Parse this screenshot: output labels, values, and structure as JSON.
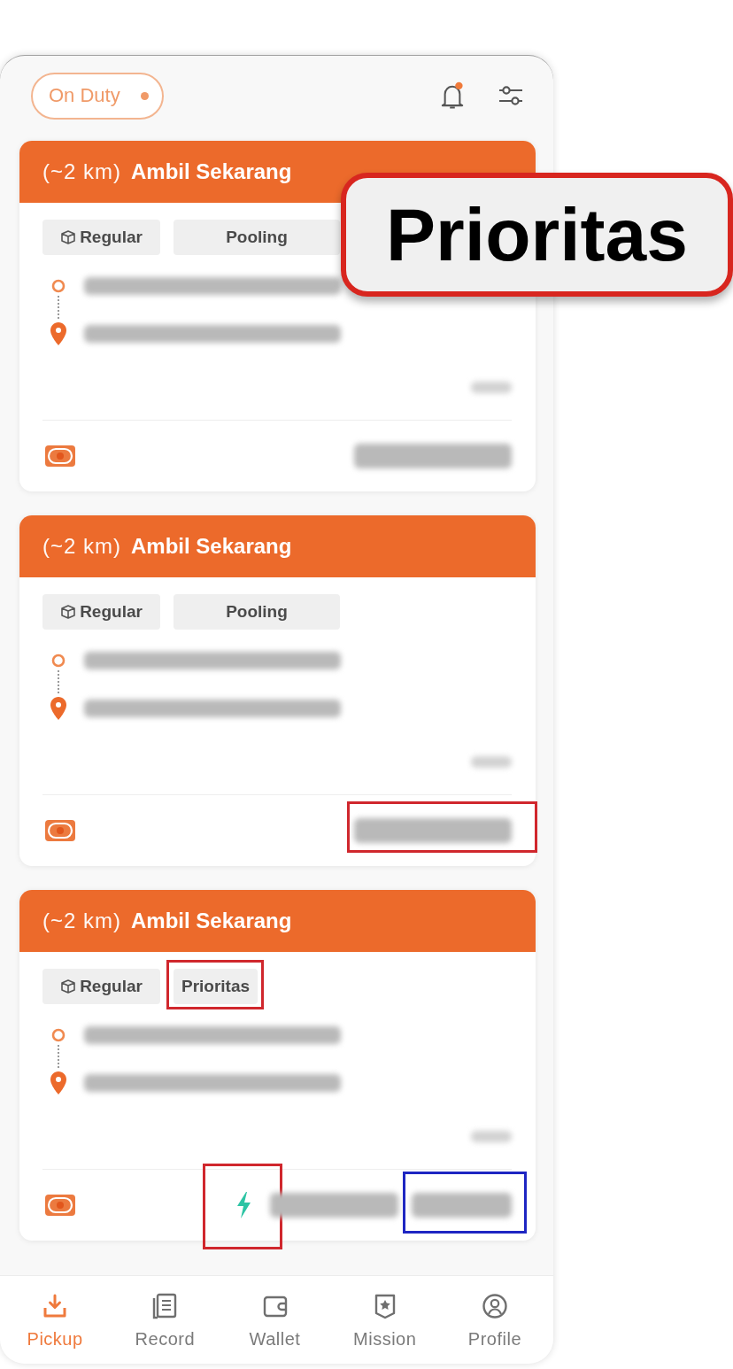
{
  "header": {
    "status": {
      "label": "On Duty",
      "on": true
    },
    "notifications": {
      "unread": true
    }
  },
  "orders": [
    {
      "distance": "(~2 km)",
      "action": "Ambil Sekarang",
      "tags": [
        {
          "kind": "service",
          "label": "Regular"
        },
        {
          "kind": "mode",
          "label": "Pooling"
        }
      ],
      "stops": [
        {
          "kind": "pickup",
          "blurred": true
        },
        {
          "kind": "dropoff",
          "blurred": true
        }
      ],
      "note": {
        "blurred": true
      },
      "fare": {
        "blurred": true
      }
    },
    {
      "distance": "(~2 km)",
      "action": "Ambil Sekarang",
      "tags": [
        {
          "kind": "service",
          "label": "Regular"
        },
        {
          "kind": "mode",
          "label": "Pooling"
        }
      ],
      "stops": [
        {
          "kind": "pickup",
          "blurred": true
        },
        {
          "kind": "dropoff",
          "blurred": true
        }
      ],
      "note": {
        "blurred": true
      },
      "fare": {
        "blurred": true,
        "highlight": {
          "color": "#d0272d"
        }
      }
    },
    {
      "distance": "(~2 km)",
      "action": "Ambil Sekarang",
      "tags": [
        {
          "kind": "service",
          "label": "Regular"
        },
        {
          "kind": "priority",
          "label": "Prioritas",
          "highlight": {
            "color": "#d0272d"
          }
        }
      ],
      "stops": [
        {
          "kind": "pickup",
          "blurred": true
        },
        {
          "kind": "dropoff",
          "blurred": true
        }
      ],
      "note": {
        "blurred": true
      },
      "bonus": {
        "shown": true,
        "highlight": {
          "color": "#d0272d"
        }
      },
      "fare": {
        "blurred": true
      },
      "extra_fare": {
        "blurred": true,
        "highlight": {
          "color": "#1e26c2"
        }
      }
    }
  ],
  "nav": [
    {
      "label": "Pickup",
      "selected": true
    },
    {
      "label": "Record",
      "selected": false
    },
    {
      "label": "Wallet",
      "selected": false
    },
    {
      "label": "Mission",
      "selected": false
    },
    {
      "label": "Profile",
      "selected": false
    }
  ],
  "callout": {
    "text": "Prioritas"
  }
}
